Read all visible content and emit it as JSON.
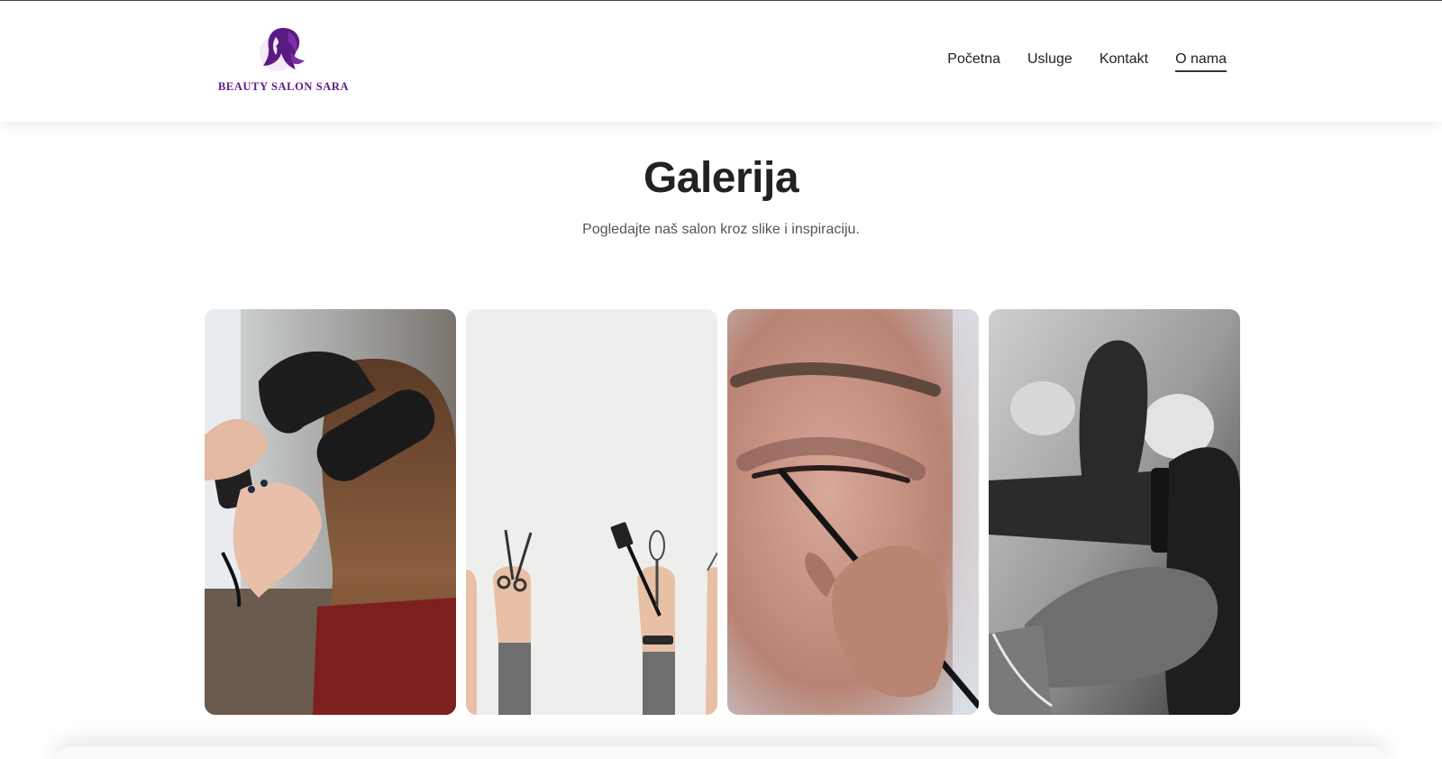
{
  "brand": {
    "name": "BEAUTY SALON SARA",
    "color": "#5b1a83",
    "logo_icon": "woman-silhouette-logo"
  },
  "nav": {
    "items": [
      {
        "label": "Početna",
        "active": false
      },
      {
        "label": "Usluge",
        "active": false
      },
      {
        "label": "Kontakt",
        "active": false
      },
      {
        "label": "O nama",
        "active": true
      }
    ]
  },
  "gallery": {
    "title": "Galerija",
    "subtitle": "Pogledajte naš salon kroz slike i inspiraciju.",
    "photos": [
      {
        "subject": "hair-blow-dry-brush-photo"
      },
      {
        "subject": "salon-tools-raised-hands-photo"
      },
      {
        "subject": "eye-makeup-brush-photo"
      },
      {
        "subject": "bw-hair-dryer-styling-photo"
      }
    ]
  }
}
